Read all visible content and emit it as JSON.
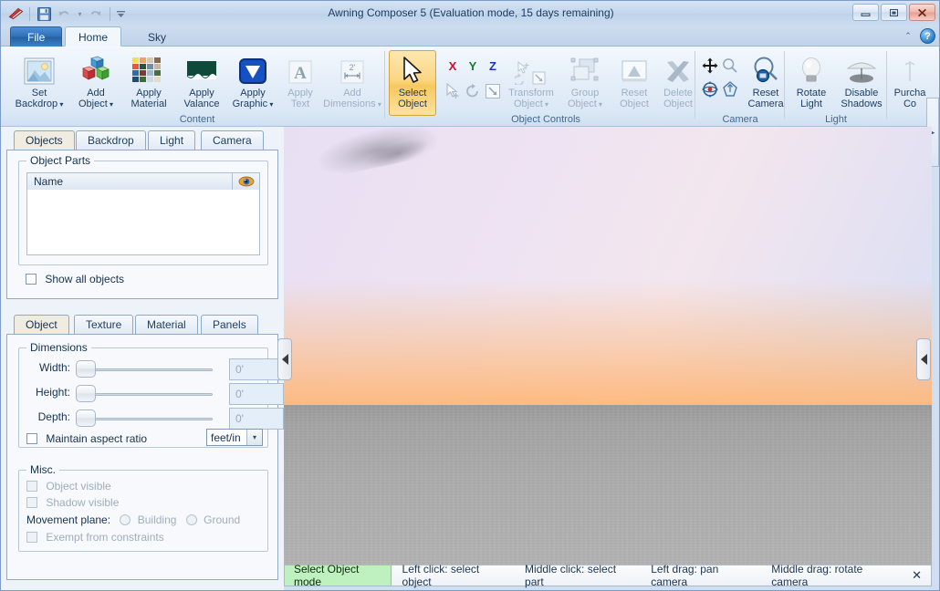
{
  "window": {
    "title": "Awning Composer 5 (Evaluation mode, 15 days remaining)",
    "app_icon": "awning-icon",
    "minimize": "–",
    "maximize": "□",
    "close": "✕"
  },
  "quick_access": {
    "save": "save-icon",
    "undo": "↶",
    "undo_caret": "▾",
    "redo": "↷",
    "customize": "▾"
  },
  "ribbon_tabs": [
    {
      "label": "File",
      "active": false
    },
    {
      "label": "Home",
      "active": true
    },
    {
      "label": "Sky",
      "active": false
    }
  ],
  "help": {
    "minimize_ribbon": "⌃",
    "help": "?"
  },
  "ribbon": {
    "scroll_right": "▸",
    "groups": [
      {
        "name": "Content",
        "label": "Content",
        "buttons": [
          {
            "label_line1": "Set",
            "label_line2": "Backdrop",
            "icon": "backdrop-icon",
            "has_caret": true,
            "disabled": false,
            "active": false
          },
          {
            "label_line1": "Add",
            "label_line2": "Object",
            "icon": "add-object-icon",
            "has_caret": true,
            "disabled": false,
            "active": false
          },
          {
            "label_line1": "Apply",
            "label_line2": "Material",
            "icon": "material-palette-icon",
            "has_caret": false,
            "disabled": false,
            "active": false
          },
          {
            "label_line1": "Apply",
            "label_line2": "Valance",
            "icon": "valance-icon",
            "has_caret": false,
            "disabled": false,
            "active": false
          },
          {
            "label_line1": "Apply",
            "label_line2": "Graphic",
            "icon": "graphic-icon",
            "has_caret": true,
            "disabled": false,
            "active": false
          },
          {
            "label_line1": "Apply",
            "label_line2": "Text",
            "icon": "text-icon",
            "has_caret": false,
            "disabled": true,
            "active": false
          },
          {
            "label_line1": "Add",
            "label_line2": "Dimensions",
            "icon": "dimensions-icon",
            "has_caret": true,
            "disabled": true,
            "active": false
          }
        ]
      },
      {
        "name": "ObjectControls",
        "label": "Object Controls",
        "buttons": [
          {
            "label_line1": "Select",
            "label_line2": "Object",
            "icon": "cursor-icon",
            "has_caret": false,
            "disabled": false,
            "active": true
          },
          {
            "label_line1": "Transform",
            "label_line2": "Object",
            "icon": "transform-icon",
            "has_caret": true,
            "disabled": true,
            "active": false
          },
          {
            "label_line1": "Group",
            "label_line2": "Object",
            "icon": "group-icon",
            "has_caret": true,
            "disabled": true,
            "active": false
          },
          {
            "label_line1": "Reset",
            "label_line2": "Object",
            "icon": "reset-object-icon",
            "has_caret": false,
            "disabled": true,
            "active": false
          },
          {
            "label_line1": "Delete",
            "label_line2": "Object",
            "icon": "delete-x-icon",
            "has_caret": false,
            "disabled": true,
            "active": false
          }
        ],
        "axes": [
          {
            "label": "X",
            "color": "#c8102e"
          },
          {
            "label": "Y",
            "color": "#1a7a35"
          },
          {
            "label": "Z",
            "color": "#1336b8"
          }
        ],
        "small_tools": [
          {
            "icon": "move-cursor-icon"
          },
          {
            "icon": "rotate-icon"
          },
          {
            "icon": "scale-icon"
          }
        ]
      },
      {
        "name": "Camera",
        "label": "Camera",
        "small_tools": [
          {
            "icon": "pan-camera-icon"
          },
          {
            "icon": "zoom-camera-icon"
          },
          {
            "icon": "orbit-camera-icon"
          },
          {
            "icon": "walk-camera-icon"
          }
        ],
        "buttons": [
          {
            "label_line1": "Reset",
            "label_line2": "Camera",
            "icon": "reset-camera-icon",
            "has_caret": false,
            "disabled": false,
            "active": false
          }
        ]
      },
      {
        "name": "Light",
        "label": "Light",
        "buttons": [
          {
            "label_line1": "Rotate",
            "label_line2": "Light",
            "icon": "lightbulb-icon",
            "has_caret": false,
            "disabled": false,
            "active": false
          },
          {
            "label_line1": "Disable",
            "label_line2": "Shadows",
            "icon": "shadow-umbrella-icon",
            "has_caret": false,
            "disabled": false,
            "active": false
          }
        ]
      },
      {
        "name": "Purchase",
        "label": "",
        "buttons": [
          {
            "label_line1": "Purcha",
            "label_line2": "Co",
            "icon": "purchase-icon",
            "has_caret": false,
            "disabled": false,
            "active": false
          }
        ]
      }
    ]
  },
  "left_panel": {
    "top_tabs": [
      {
        "label": "Objects",
        "selected": true
      },
      {
        "label": "Backdrop",
        "selected": false
      },
      {
        "label": "Light",
        "selected": false
      },
      {
        "label": "Camera",
        "selected": false
      }
    ],
    "object_parts": {
      "title": "Object Parts",
      "column_name": "Name",
      "eye_icon": "eye-icon",
      "rows": [],
      "show_all_label": "Show all objects",
      "show_all_checked": false
    },
    "bottom_tabs": [
      {
        "label": "Object",
        "selected": true
      },
      {
        "label": "Texture",
        "selected": false
      },
      {
        "label": "Material",
        "selected": false
      },
      {
        "label": "Panels",
        "selected": false
      }
    ],
    "dimensions": {
      "title": "Dimensions",
      "rows": [
        {
          "label": "Width:",
          "value": "0'",
          "slider_pct": 0
        },
        {
          "label": "Height:",
          "value": "0'",
          "slider_pct": 0
        },
        {
          "label": "Depth:",
          "value": "0'",
          "slider_pct": 0
        }
      ],
      "maintain_aspect_label": "Maintain aspect ratio",
      "maintain_aspect_checked": false,
      "units_value": "feet/in",
      "units_caret": "▾"
    },
    "misc": {
      "title": "Misc.",
      "object_visible_label": "Object visible",
      "object_visible_checked": false,
      "shadow_visible_label": "Shadow visible",
      "shadow_visible_checked": false,
      "movement_plane_label": "Movement plane:",
      "movement_options": [
        {
          "label": "Building",
          "selected": false
        },
        {
          "label": "Ground",
          "selected": false
        }
      ],
      "exempt_label": "Exempt from constraints",
      "exempt_checked": false
    }
  },
  "viewport": {
    "collapse_left": "◀",
    "collapse_right": "◀",
    "sky_top_color": "#b9c6ee",
    "sky_mid_color": "#f0e4f0",
    "sky_horizon_color": "#ffc08a",
    "ground_color": "#a8a8a8"
  },
  "status_bar": {
    "mode": "Select Object mode",
    "mode_color": "#bff0bf",
    "hints": [
      "Left click: select object",
      "Middle click: select part",
      "Left drag: pan camera",
      "Middle drag: rotate camera"
    ],
    "close": "✕"
  }
}
